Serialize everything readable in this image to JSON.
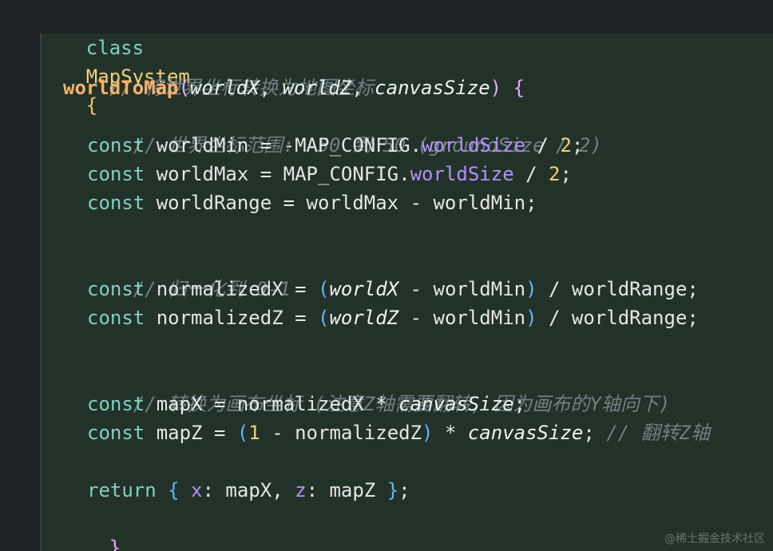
{
  "code": {
    "l1": {
      "kw": "class",
      "name": "MapSystem",
      "brace": "{"
    },
    "l2": {
      "comment": "// 将世界坐标转换为地图坐标"
    },
    "l3": {
      "fn": "worldToMap",
      "open": "(",
      "p1": "worldX",
      "sep1": ", ",
      "p2": "worldZ",
      "sep2": ", ",
      "p3": "canvasSize",
      "close": ")",
      "brace": " {"
    },
    "l4": {
      "comment": "// 世界坐标范围: -50 到 50 (groundSize / 2)"
    },
    "l5": {
      "kw": "const",
      "rest1": " worldMin = -MAP_CONFIG.",
      "prop": "worldSize",
      "rest2": " / ",
      "num": "2",
      "end": ";"
    },
    "l6": {
      "kw": "const",
      "rest1": " worldMax = MAP_CONFIG.",
      "prop": "worldSize",
      "rest2": " / ",
      "num": "2",
      "end": ";"
    },
    "l7": {
      "kw": "const",
      "rest": " worldRange = worldMax - worldMin;"
    },
    "l8": {
      "comment": "// 归一化到 0-1"
    },
    "l9": {
      "kw": "const",
      "pre": " normalizedX = ",
      "open": "(",
      "param": "worldX",
      "mid": " - worldMin",
      "close": ")",
      "post": " / worldRange;"
    },
    "l10": {
      "kw": "const",
      "pre": " normalizedZ = ",
      "open": "(",
      "param": "worldZ",
      "mid": " - worldMin",
      "close": ")",
      "post": " / worldRange;"
    },
    "l11": {
      "comment": "// 转换为画布坐标 (注意Z轴需要翻转, 因为画布的Y轴向下)"
    },
    "l12": {
      "kw": "const",
      "pre": " mapX = normalizedX * ",
      "param": "canvasSize",
      "end": ";"
    },
    "l13": {
      "kw": "const",
      "pre": " mapZ = ",
      "open": "(",
      "num": "1",
      "mid": " - normalizedZ",
      "close": ")",
      "star": " * ",
      "param": "canvasSize",
      "end": ";",
      "comment": " // 翻转Z轴"
    },
    "l14": {
      "kw": "return",
      "brace1": " {",
      "key1": " x",
      "colon1": ": mapX, ",
      "key2": "z",
      "colon2": ": mapZ ",
      "brace2": "}",
      "end": ";"
    },
    "l15": {
      "brace": "}"
    }
  },
  "watermark": "@稀土掘金技术社区",
  "colors": {
    "background": "#1f2226",
    "block_background": "#233228",
    "keyword": "#7fd0c7",
    "function": "#f7b26b",
    "comment": "#6f7f86",
    "property": "#b290ff",
    "number": "#f1d27a"
  }
}
